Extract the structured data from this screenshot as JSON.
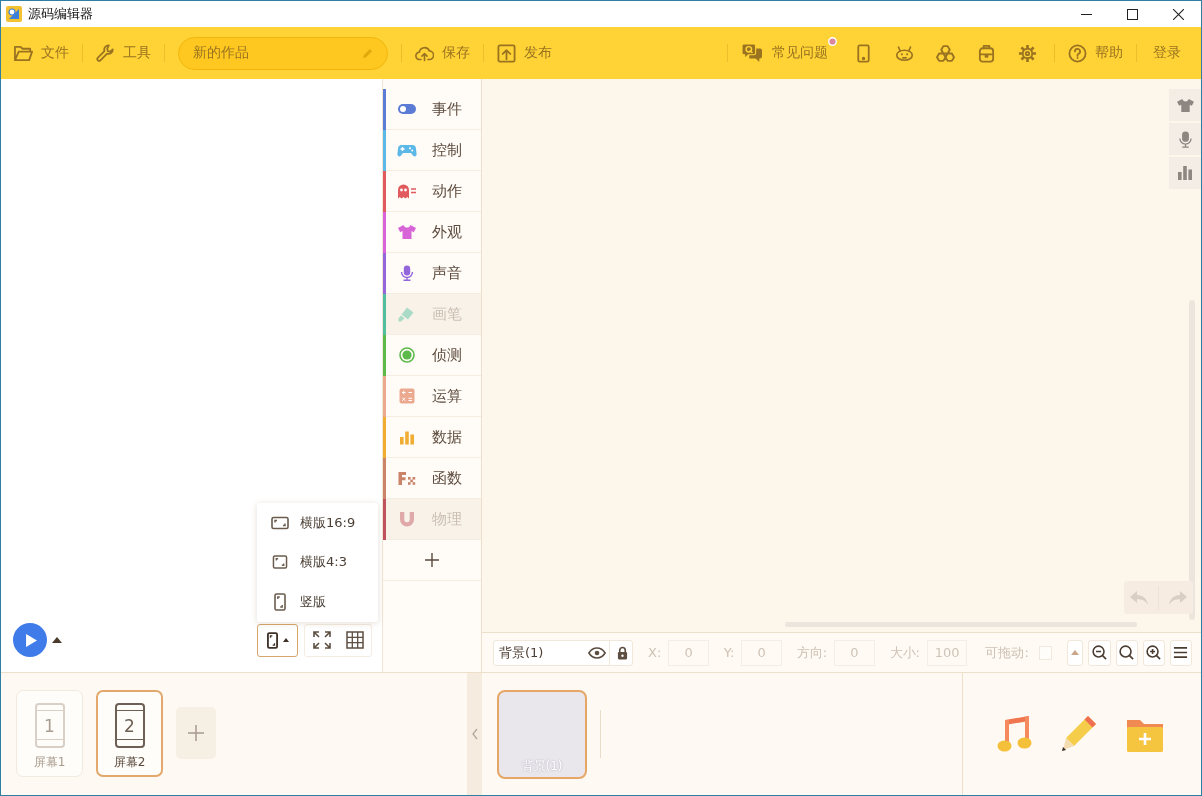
{
  "window": {
    "title": "源码编辑器"
  },
  "toolbar": {
    "menus": [
      {
        "label": "文件"
      },
      {
        "label": "工具"
      }
    ],
    "project_name": "新的作品",
    "actions": [
      {
        "label": "保存"
      },
      {
        "label": "发布"
      }
    ],
    "faq": {
      "label": "常见问题",
      "notification": true
    },
    "help": {
      "label": "帮助"
    },
    "login": {
      "label": "登录"
    }
  },
  "stage": {
    "orientation_menu": {
      "open": true,
      "items": [
        {
          "label": "横版16:9"
        },
        {
          "label": "横版4:3"
        },
        {
          "label": "竖版"
        }
      ]
    }
  },
  "categories": [
    {
      "label": "事件",
      "color": "#5b7bd5",
      "disabled": false
    },
    {
      "label": "控制",
      "color": "#5cb8e6",
      "disabled": false
    },
    {
      "label": "动作",
      "color": "#e05a5e",
      "disabled": false
    },
    {
      "label": "外观",
      "color": "#d865d8",
      "disabled": false
    },
    {
      "label": "声音",
      "color": "#9466dc",
      "disabled": false
    },
    {
      "label": "画笔",
      "color": "#4fbf9f",
      "disabled": true
    },
    {
      "label": "侦测",
      "color": "#5cba4a",
      "disabled": false
    },
    {
      "label": "运算",
      "color": "#eba98f",
      "disabled": false
    },
    {
      "label": "数据",
      "color": "#f0ad32",
      "disabled": false
    },
    {
      "label": "函数",
      "color": "#c9846a",
      "disabled": false
    },
    {
      "label": "物理",
      "color": "#c0525f",
      "disabled": true
    }
  ],
  "properties": {
    "sprite_name": "背景(1)",
    "fields": [
      {
        "label": "X:",
        "value": "0"
      },
      {
        "label": "Y:",
        "value": "0"
      },
      {
        "label": "方向:",
        "value": "0"
      },
      {
        "label": "大小:",
        "value": "100"
      }
    ],
    "draggable": {
      "label": "可拖动:",
      "checked": false
    }
  },
  "screens": [
    {
      "number": "1",
      "label": "屏幕1",
      "selected": false
    },
    {
      "number": "2",
      "label": "屏幕2",
      "selected": true
    }
  ],
  "sprites": [
    {
      "label": "背景(1)",
      "selected": true
    }
  ]
}
